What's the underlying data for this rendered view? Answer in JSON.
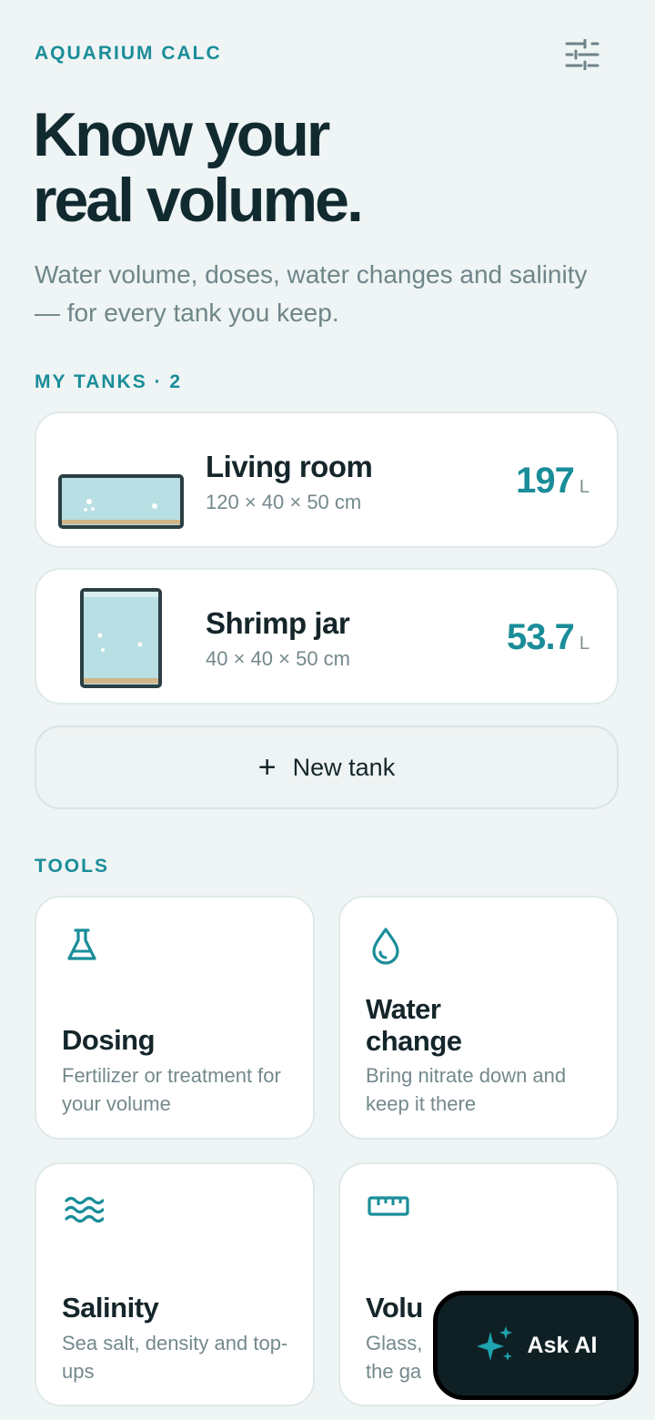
{
  "app": {
    "eyebrow": "AQUARIUM CALC",
    "settings_icon": "sliders-icon"
  },
  "hero": {
    "title_line1": "Know your",
    "title_line2": "real volume.",
    "subtitle": "Water volume, doses, water changes and salinity — for every tank you keep."
  },
  "tanks": {
    "heading": "MY TANKS · 2",
    "items": [
      {
        "name": "Living room",
        "dims": "120 × 40 × 50 cm",
        "volume": "197",
        "unit": "L"
      },
      {
        "name": "Shrimp jar",
        "dims": "40 × 40 × 50 cm",
        "volume": "53.7",
        "unit": "L"
      }
    ],
    "new_label": "New tank"
  },
  "tools": {
    "heading": "TOOLS",
    "items": [
      {
        "icon": "flask-icon",
        "title": "Dosing",
        "desc": "Fertilizer or treatment for your volume"
      },
      {
        "icon": "droplet-icon",
        "title_line1": "Water",
        "title_line2": "change",
        "desc": "Bring nitrate down and keep it there"
      },
      {
        "icon": "waves-icon",
        "title": "Salinity",
        "desc": "Sea salt, density and top-ups"
      },
      {
        "icon": "ruler-icon",
        "title": "Volu",
        "desc_line1": "Glass,",
        "desc_line2": "the ga"
      }
    ]
  },
  "ask_ai": {
    "label": "Ask AI",
    "icon": "sparkle-icon"
  },
  "colors": {
    "accent": "#1a8d99",
    "background": "#eff4f4",
    "ink": "#112a30",
    "water": "#b8dfe3",
    "fab": "#0f2025"
  }
}
